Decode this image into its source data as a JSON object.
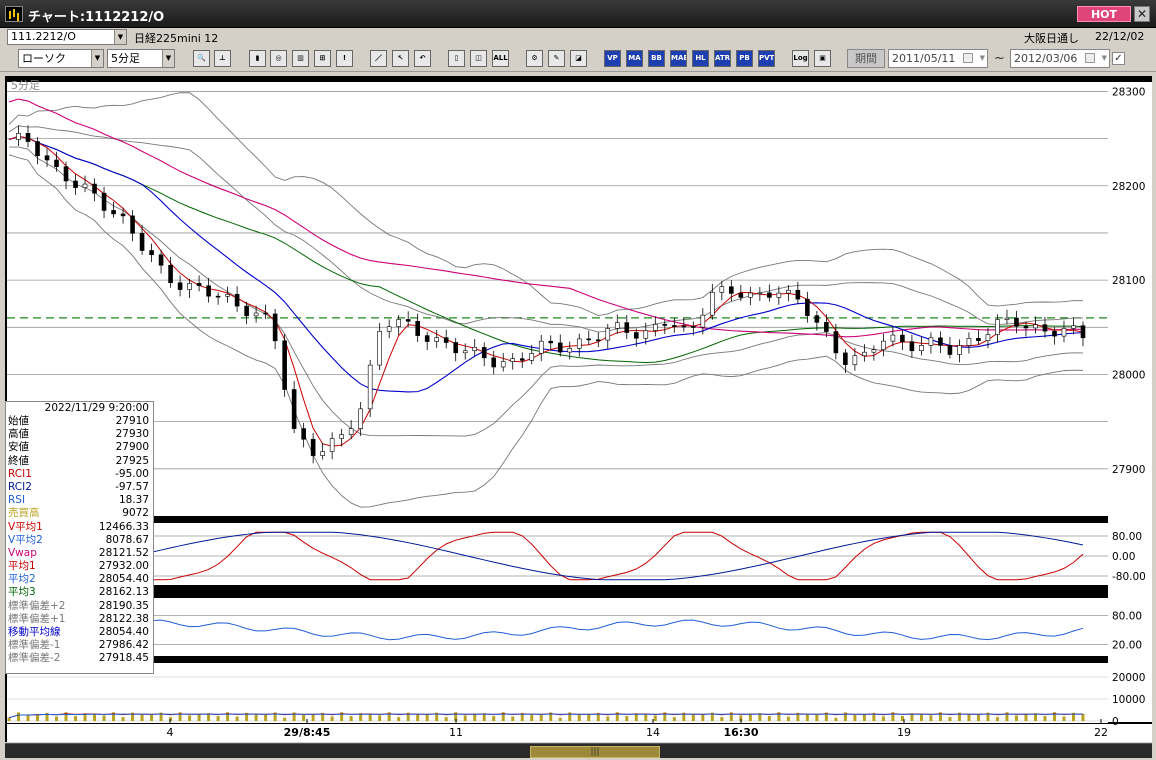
{
  "window": {
    "title": "チャート:1112212/O",
    "hot_label": "HOT",
    "close_label": "✕"
  },
  "header": {
    "code": "111.2212/O",
    "instrument": "日経225mini 12",
    "exchange": "大阪日通し",
    "date": "22/12/02"
  },
  "toolbar": {
    "chart_type": "ローソク",
    "interval": "5分足",
    "icons": [
      {
        "name": "zoom-icon",
        "glyph": "🔍"
      },
      {
        "name": "cursor-icon",
        "glyph": "⊥"
      },
      {
        "name": "candle-icon",
        "glyph": "▮"
      },
      {
        "name": "magnify-icon",
        "glyph": "◎"
      },
      {
        "name": "bar-chart-icon",
        "glyph": "▥"
      },
      {
        "name": "indicator-icon",
        "glyph": "⊞"
      },
      {
        "name": "info-icon",
        "glyph": "!"
      },
      {
        "name": "draw-line-icon",
        "glyph": "／"
      },
      {
        "name": "arrow-icon",
        "glyph": "↖"
      },
      {
        "name": "undo-icon",
        "glyph": "↶"
      },
      {
        "name": "candle-small-icon",
        "glyph": "▯"
      },
      {
        "name": "candle-zoom-icon",
        "glyph": "◫"
      },
      {
        "name": "all-icon",
        "glyph": "ALL"
      },
      {
        "name": "settings-icon",
        "glyph": "⚙"
      },
      {
        "name": "tools-icon",
        "glyph": "✎"
      },
      {
        "name": "color-icon",
        "glyph": "◪"
      },
      {
        "name": "vp-icon",
        "glyph": "VP"
      },
      {
        "name": "ma-icon",
        "glyph": "MA"
      },
      {
        "name": "bb-icon",
        "glyph": "BB"
      },
      {
        "name": "mae-icon",
        "glyph": "MAE"
      },
      {
        "name": "hl-icon",
        "glyph": "HL"
      },
      {
        "name": "atr-icon",
        "glyph": "ATR"
      },
      {
        "name": "pb-icon",
        "glyph": "PB"
      },
      {
        "name": "pvt-icon",
        "glyph": "PVT"
      },
      {
        "name": "log-icon",
        "glyph": "Log"
      },
      {
        "name": "save-icon",
        "glyph": "▣"
      }
    ],
    "period_label": "期間",
    "date_from": "2011/05/11",
    "date_to": "2012/03/06",
    "tilde": "~",
    "check": "✓"
  },
  "chart": {
    "interval_label": "5分足",
    "price_ticks": [
      "28300",
      "28200",
      "28100",
      "28000",
      "27900"
    ],
    "osc_ticks": [
      "80.00",
      "0.00",
      "-80.00"
    ],
    "rsi_ticks": [
      "80.00",
      "20.00"
    ],
    "vol_ticks": [
      "20000",
      "10000",
      "0"
    ],
    "x_ticks": [
      "4",
      "29/8:45",
      "11",
      "14",
      "16:30",
      "19",
      "22"
    ],
    "dashed_level": 28060,
    "colors": {
      "up": "#ffffff",
      "down": "#000000",
      "ma1": "#cc0000",
      "ma2": "#0000cc",
      "ma3": "#006600",
      "vwap": "#cc0077",
      "bb": "#777777",
      "rci1": "#cc0000",
      "rci2": "#001a99",
      "rsi": "#1f5fd6",
      "vol": "#b8a21e"
    }
  },
  "chart_data": {
    "type": "candlestick",
    "x_ticks": [
      "4",
      "29/8:45",
      "11",
      "14",
      "16:30",
      "19",
      "22"
    ],
    "ylim": [
      27850,
      28310
    ],
    "ohlc_approx": [
      28245,
      28250,
      28220,
      28198,
      28190,
      28170,
      28135,
      28110,
      28095,
      28085,
      28080,
      28070,
      28050,
      27940,
      27920,
      27925,
      27960,
      28060,
      28050,
      28040,
      28035,
      28020,
      28015,
      28015,
      28025,
      28030,
      28035,
      28040,
      28050,
      28045,
      28055,
      28040,
      28090,
      28085,
      28080,
      28095,
      28075,
      28050,
      28020,
      28015,
      28040,
      28035,
      28030,
      28025,
      28040,
      28050,
      28055,
      28050,
      28045,
      28040
    ]
  },
  "info": {
    "timestamp": "2022/11/29 9:20:00",
    "rows": [
      {
        "label": "始値",
        "value": "27910",
        "color": "#000000"
      },
      {
        "label": "高値",
        "value": "27930",
        "color": "#000000"
      },
      {
        "label": "安値",
        "value": "27900",
        "color": "#000000"
      },
      {
        "label": "終値",
        "value": "27925",
        "color": "#000000"
      },
      {
        "label": "RCI1",
        "value": "-95.00",
        "color": "#cc0000"
      },
      {
        "label": "RCI2",
        "value": "-97.57",
        "color": "#001a99"
      },
      {
        "label": "RSI",
        "value": "18.37",
        "color": "#1f5fd6"
      },
      {
        "label": "売買高",
        "value": "9072",
        "color": "#b8a21e"
      },
      {
        "label": "V平均1",
        "value": "12466.33",
        "color": "#cc0000"
      },
      {
        "label": "V平均2",
        "value": "8078.67",
        "color": "#1f5fd6"
      },
      {
        "label": "Vwap",
        "value": "28121.52",
        "color": "#cc0077"
      },
      {
        "label": "平均1",
        "value": "27932.00",
        "color": "#cc0000"
      },
      {
        "label": "平均2",
        "value": "28054.40",
        "color": "#1f5fd6"
      },
      {
        "label": "平均3",
        "value": "28162.13",
        "color": "#006600"
      },
      {
        "label": "標準偏差+2",
        "value": "28190.35",
        "color": "#777777"
      },
      {
        "label": "標準偏差+1",
        "value": "28122.38",
        "color": "#777777"
      },
      {
        "label": "移動平均線",
        "value": "28054.40",
        "color": "#0000cc"
      },
      {
        "label": "標準偏差-1",
        "value": "27986.42",
        "color": "#777777"
      },
      {
        "label": "標準偏差-2",
        "value": "27918.45",
        "color": "#777777"
      }
    ]
  },
  "scrollbar": {
    "thumb_label": "|||"
  }
}
